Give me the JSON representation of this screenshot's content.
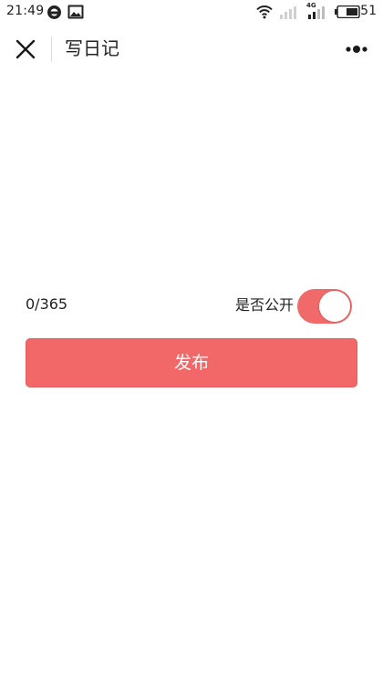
{
  "status_bar": {
    "time": "21:49",
    "battery_level": "51",
    "network_label": "4G",
    "icons": [
      "notification-circle-icon",
      "image-icon",
      "wifi-icon",
      "signal-empty-icon",
      "signal-4g-icon",
      "battery-icon"
    ]
  },
  "nav": {
    "title": "写日记",
    "icons": [
      "close-icon",
      "more-icon"
    ]
  },
  "editor": {
    "counter": "0/365",
    "public_label": "是否公开",
    "public_toggle_on": true
  },
  "actions": {
    "publish_label": "发布"
  },
  "colors": {
    "accent": "#f26868",
    "accent_border": "#e05e5e",
    "background": "#ffffff",
    "text": "#222222"
  }
}
